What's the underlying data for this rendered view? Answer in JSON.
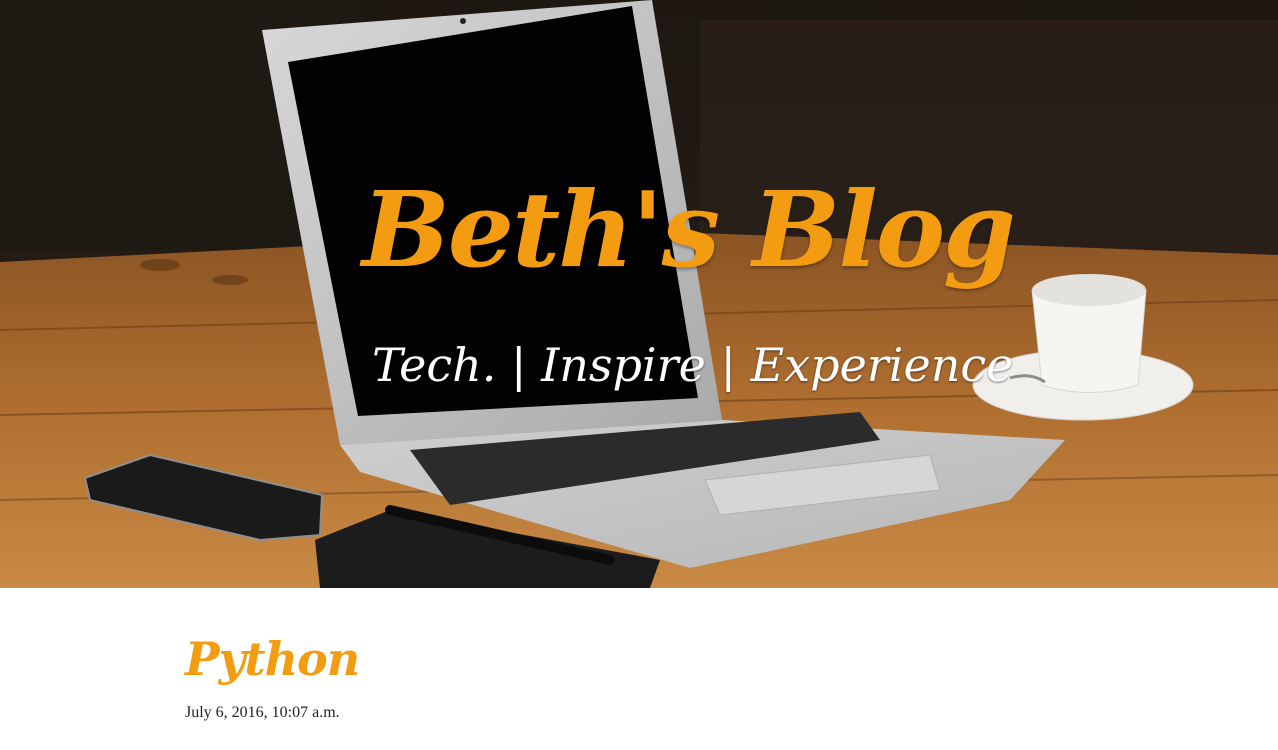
{
  "header": {
    "title": "Beth's Blog",
    "tagline": "Tech. | Inspire | Experience"
  },
  "post": {
    "title": "Python",
    "date": "July 6, 2016, 10:07 a.m."
  },
  "colors": {
    "accent": "#f39c12",
    "tagline": "#ffffff",
    "date_text": "#222222",
    "page_background": "#ffffff"
  }
}
